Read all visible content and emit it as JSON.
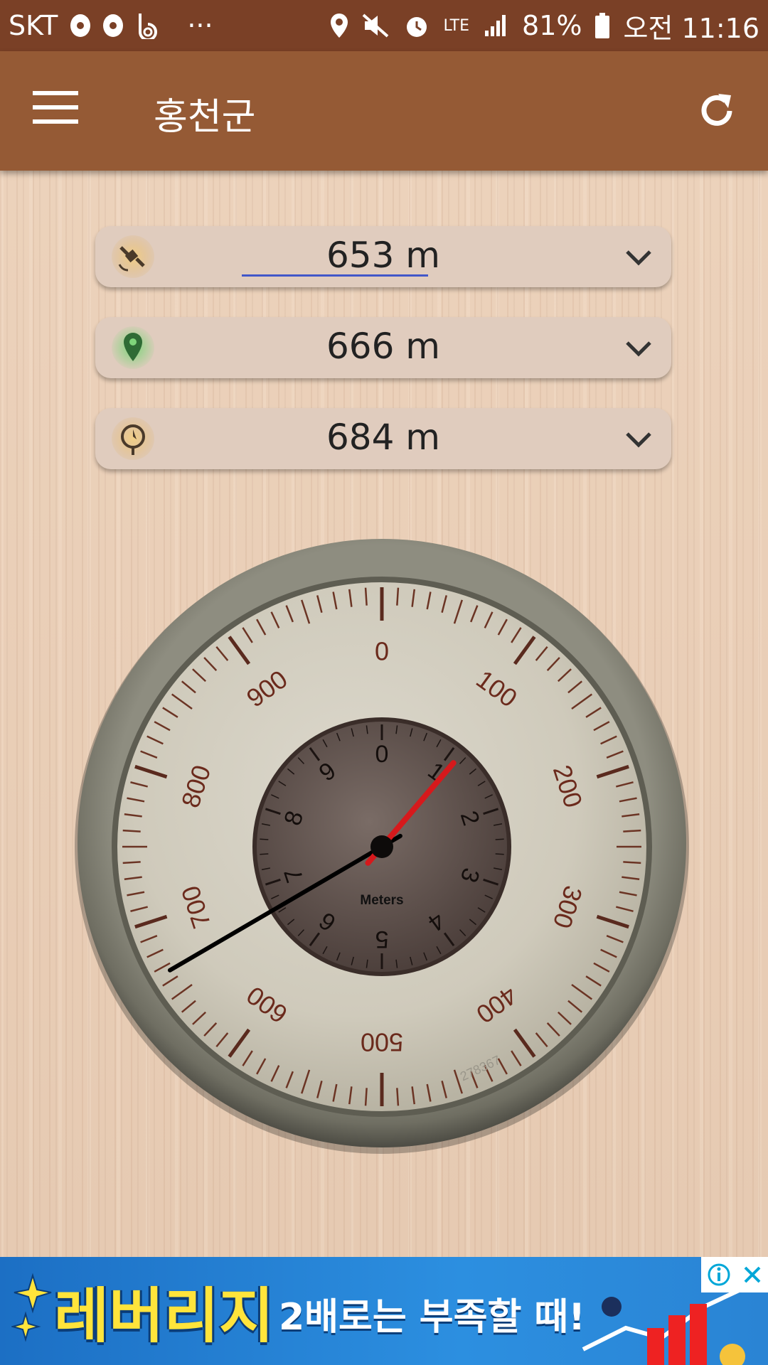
{
  "status_bar": {
    "carrier": "SKT",
    "more": "···",
    "network": "LTE",
    "battery": "81%",
    "time": "오전 11:16"
  },
  "toolbar": {
    "title": "홍천군",
    "menu_icon": "hamburger-menu-icon",
    "refresh_icon": "refresh-icon"
  },
  "altitude_sources": [
    {
      "icon": "satellite-gps-icon",
      "value": "653 m",
      "icon_color": "#e9c07a"
    },
    {
      "icon": "map-pin-icon",
      "value": "666 m",
      "icon_color": "#3f8e44"
    },
    {
      "icon": "barometer-icon",
      "value": "684 m",
      "icon_color": "#e9c07a"
    }
  ],
  "altimeter": {
    "outer_labels": [
      "0",
      "100",
      "200",
      "300",
      "400",
      "500",
      "600",
      "700",
      "800",
      "900"
    ],
    "inner_labels": [
      "0",
      "1",
      "2",
      "3",
      "4",
      "5",
      "6",
      "7",
      "8",
      "9"
    ],
    "inner_caption": "Meters",
    "serial": "278367",
    "reading_m": 666
  },
  "ad": {
    "headline": "레버리지",
    "subtext": "2배로는 부족할 때!",
    "info_icon": "ad-info-icon",
    "close_icon": "close-icon"
  },
  "colors": {
    "status_bar": "#7a4026",
    "toolbar": "#955a35",
    "needle_long": "#000000",
    "needle_short": "#d6191c"
  }
}
